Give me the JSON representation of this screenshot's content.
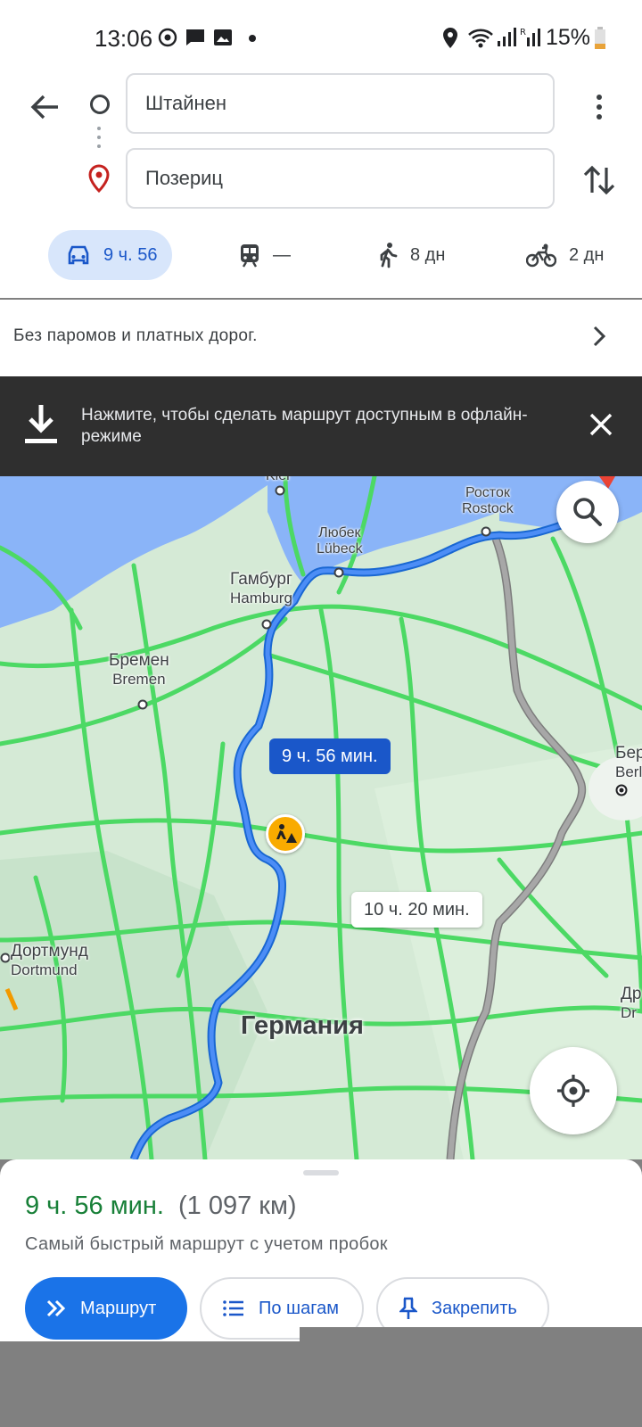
{
  "status_bar": {
    "time": "13:06",
    "battery": "15%",
    "icons": [
      "sync-icon",
      "chat-icon",
      "image-icon",
      "dot-icon",
      "location-icon",
      "wifi-icon",
      "signal-icon",
      "signal-roaming-icon",
      "battery-icon"
    ]
  },
  "directions": {
    "origin": "Штайнен",
    "destination": "Позериц",
    "modes": [
      {
        "name": "car",
        "label": "9 ч. 56",
        "selected": true
      },
      {
        "name": "transit",
        "label": "—"
      },
      {
        "name": "walk",
        "label": "8 дн"
      },
      {
        "name": "bike",
        "label": "2 дн"
      }
    ],
    "options_text": "Без паромов и платных дорог."
  },
  "offline_banner": {
    "text": "Нажмите, чтобы сделать маршрут доступным в офлайн-режиме"
  },
  "map": {
    "cities": {
      "kiel": "Kiel",
      "rostock_ru": "Росток",
      "rostock": "Rostock",
      "lubeck_ru": "Любек",
      "lubeck": "Lübeck",
      "hamburg_ru": "Гамбург",
      "hamburg": "Hamburg",
      "bremen_ru": "Бремен",
      "bremen": "Bremen",
      "berlin_ru": "Берли",
      "berlin": "Berlin",
      "dortmund_ru": "Дортмунд",
      "dortmund": "Dortmund",
      "dresden_ru": "Др",
      "dresden": "Dr"
    },
    "country": "Германия",
    "route_main_label": "9 ч. 56 мин.",
    "route_alt_label": "10 ч. 20 мин.",
    "colors": {
      "route": "#3b78e7",
      "route_alt": "#9e9e9e",
      "traffic": "#4cd964",
      "water": "#8ab4f8"
    }
  },
  "summary": {
    "time": "9 ч. 56 мин.",
    "distance": "(1 097 км)",
    "description": "Самый быстрый маршрут с учетом пробок",
    "buttons": {
      "route": "Маршрут",
      "steps": "По шагам",
      "pin": "Закрепить"
    }
  }
}
